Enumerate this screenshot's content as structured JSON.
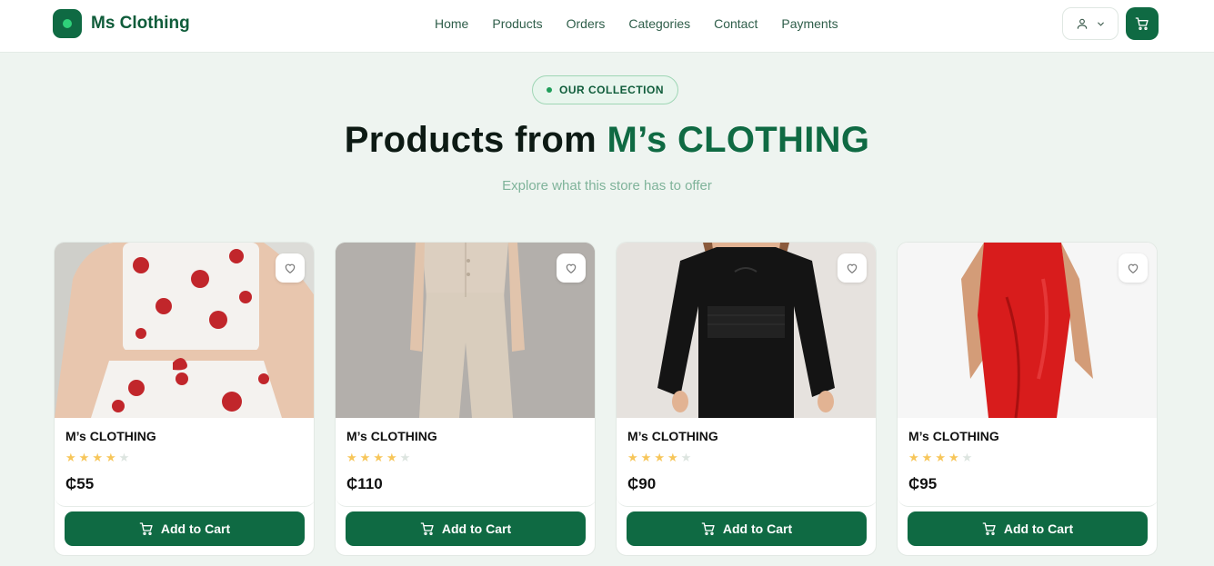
{
  "brand": {
    "name": "Ms Clothing"
  },
  "nav": {
    "items": [
      "Home",
      "Products",
      "Orders",
      "Categories",
      "Contact",
      "Payments"
    ]
  },
  "header": {
    "account_icon": "user-icon",
    "dropdown_icon": "chevron-down-icon",
    "cart_icon": "shopping-cart-icon"
  },
  "hero": {
    "badge": "OUR COLLECTION",
    "title_prefix": "Products from ",
    "title_accent": "M’s CLOTHING",
    "subtitle": "Explore what this store has to offer"
  },
  "products": [
    {
      "name": "M’s CLOTHING",
      "rating": 4,
      "rating_max": 5,
      "price": "₵55",
      "cta": "Add to Cart",
      "image": "white heart-print pajama set"
    },
    {
      "name": "M’s CLOTHING",
      "rating": 4,
      "rating_max": 5,
      "price": "₵110",
      "cta": "Add to Cart",
      "image": "beige vest and wide-leg trousers"
    },
    {
      "name": "M’s CLOTHING",
      "rating": 4,
      "rating_max": 5,
      "price": "₵90",
      "cta": "Add to Cart",
      "image": "black long-sleeve smocked dress"
    },
    {
      "name": "M’s CLOTHING",
      "rating": 4,
      "rating_max": 5,
      "price": "₵95",
      "cta": "Add to Cart",
      "image": "red satin bodycon dress"
    }
  ],
  "colors": {
    "brand": "#0f6a43",
    "background": "#eef4f0",
    "star": "#f7c65a"
  }
}
